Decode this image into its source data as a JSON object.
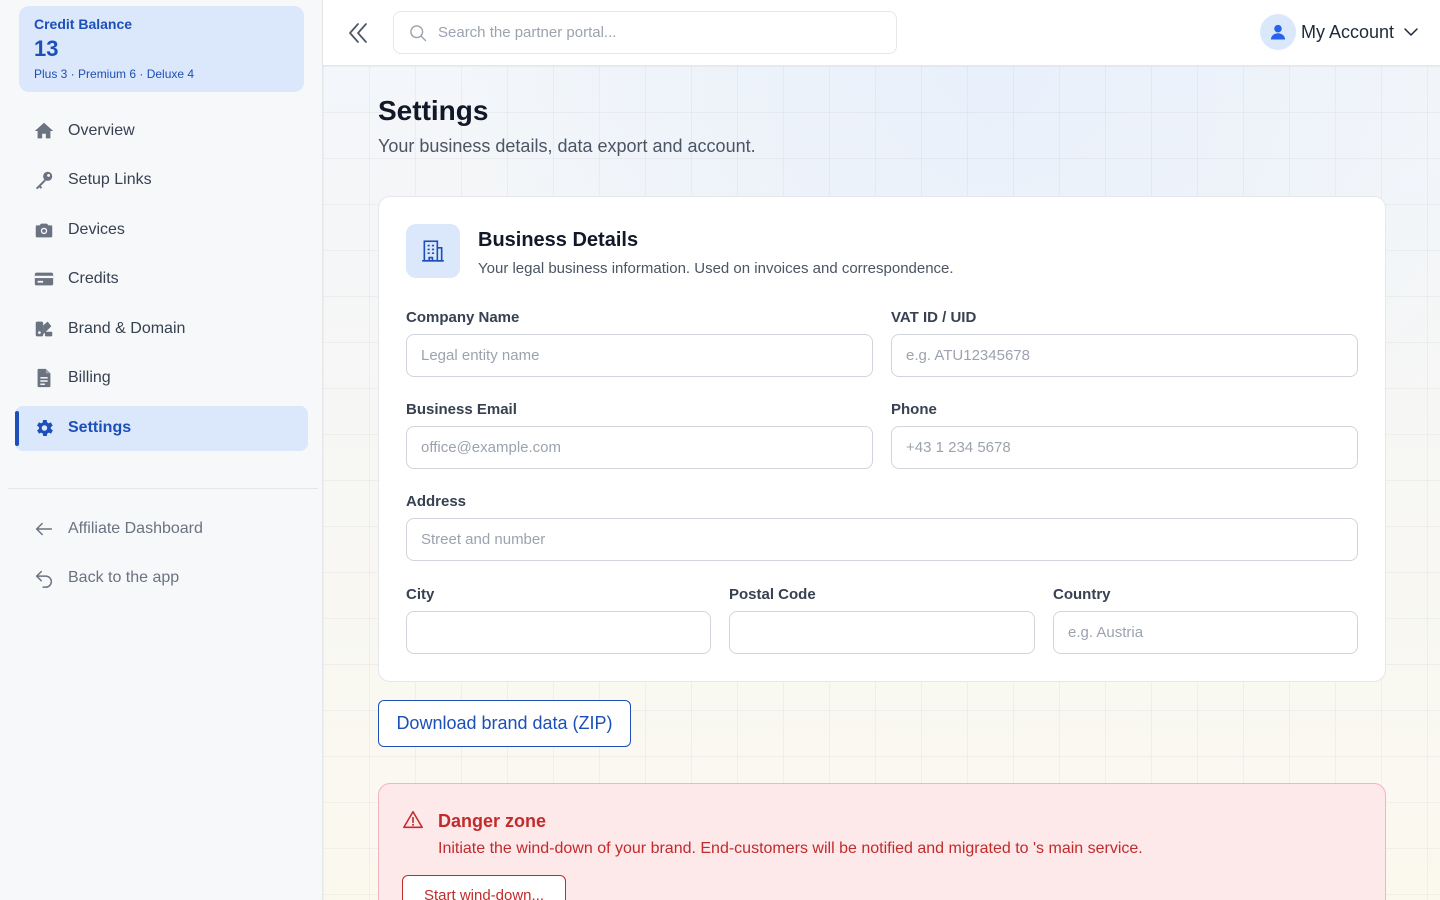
{
  "credit": {
    "title": "Credit Balance",
    "value": "13",
    "breakdown": "Plus 3 · Premium 6 · Deluxe 4"
  },
  "sidebar": {
    "items": [
      {
        "label": "Overview",
        "icon": "home-icon"
      },
      {
        "label": "Setup Links",
        "icon": "key-icon"
      },
      {
        "label": "Devices",
        "icon": "camera-icon"
      },
      {
        "label": "Credits",
        "icon": "credit-card-icon"
      },
      {
        "label": "Brand & Domain",
        "icon": "brand-icon"
      },
      {
        "label": "Billing",
        "icon": "document-icon"
      },
      {
        "label": "Settings",
        "icon": "gear-icon",
        "active": true
      }
    ],
    "secondary": [
      {
        "label": "Affiliate Dashboard",
        "icon": "arrow-left-icon"
      },
      {
        "label": "Back to the app",
        "icon": "return-icon"
      }
    ]
  },
  "header": {
    "search_placeholder": "Search the partner portal...",
    "account_label": "My Account"
  },
  "page": {
    "title": "Settings",
    "subtitle": "Your business details, data export and account."
  },
  "business": {
    "title": "Business Details",
    "subtitle": "Your legal business information. Used on invoices and correspondence.",
    "fields": {
      "company": {
        "label": "Company Name",
        "placeholder": "Legal entity name",
        "value": ""
      },
      "vat": {
        "label": "VAT ID / UID",
        "placeholder": "e.g. ATU12345678",
        "value": ""
      },
      "email": {
        "label": "Business Email",
        "placeholder": "office@example.com",
        "value": ""
      },
      "phone": {
        "label": "Phone",
        "placeholder": "+43 1 234 5678",
        "value": ""
      },
      "address": {
        "label": "Address",
        "placeholder": "Street and number",
        "value": ""
      },
      "city": {
        "label": "City",
        "placeholder": "",
        "value": ""
      },
      "postal": {
        "label": "Postal Code",
        "placeholder": "",
        "value": ""
      },
      "country": {
        "label": "Country",
        "placeholder": "e.g. Austria",
        "value": ""
      }
    }
  },
  "download_label": "Download brand data (ZIP)",
  "danger": {
    "title": "Danger zone",
    "text": "Initiate the wind-down of your brand. End-customers will be notified and migrated to 's main service.",
    "button": "Start wind-down..."
  },
  "colors": {
    "accent": "#1d4fb8",
    "accent_bg": "#dbe7fb",
    "danger": "#c22b2b",
    "danger_bg": "#fde8ea"
  }
}
